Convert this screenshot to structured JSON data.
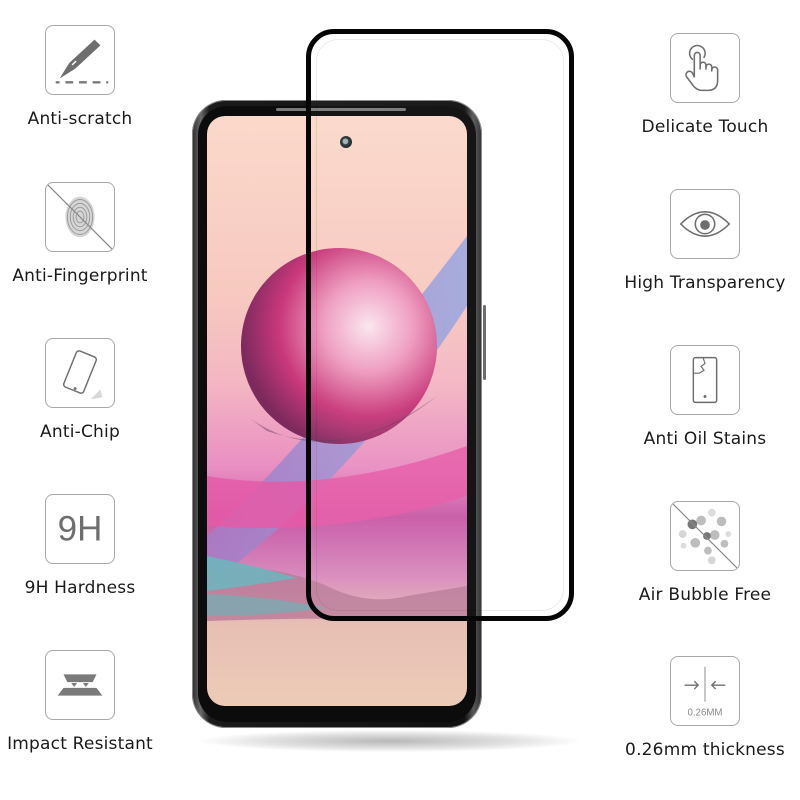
{
  "features_left": [
    {
      "label": "Anti-scratch",
      "icon": "scalpel-icon"
    },
    {
      "label": "Anti-Fingerprint",
      "icon": "fingerprint-crossed-icon"
    },
    {
      "label": "Anti-Chip",
      "icon": "phone-tilted-icon"
    },
    {
      "label": "9H Hardness",
      "icon": "9h-icon",
      "icon_text": "9H"
    },
    {
      "label": "Impact Resistant",
      "icon": "layers-impact-icon"
    }
  ],
  "features_right": [
    {
      "label": "Delicate Touch",
      "icon": "touch-hand-icon"
    },
    {
      "label": "High Transparency",
      "icon": "eye-icon"
    },
    {
      "label": "Anti Oil Stains",
      "icon": "cracked-phone-icon"
    },
    {
      "label": "Air Bubble Free",
      "icon": "bubbles-crossed-icon"
    },
    {
      "label": "0.26mm thickness",
      "icon": "thickness-arrows-icon",
      "icon_text": "0.26MM"
    }
  ],
  "colors": {
    "icon_stroke": "#8a8a8a",
    "icon_fill": "#777777",
    "label_text": "#1a1a1a",
    "protector_edge": "#050505"
  }
}
